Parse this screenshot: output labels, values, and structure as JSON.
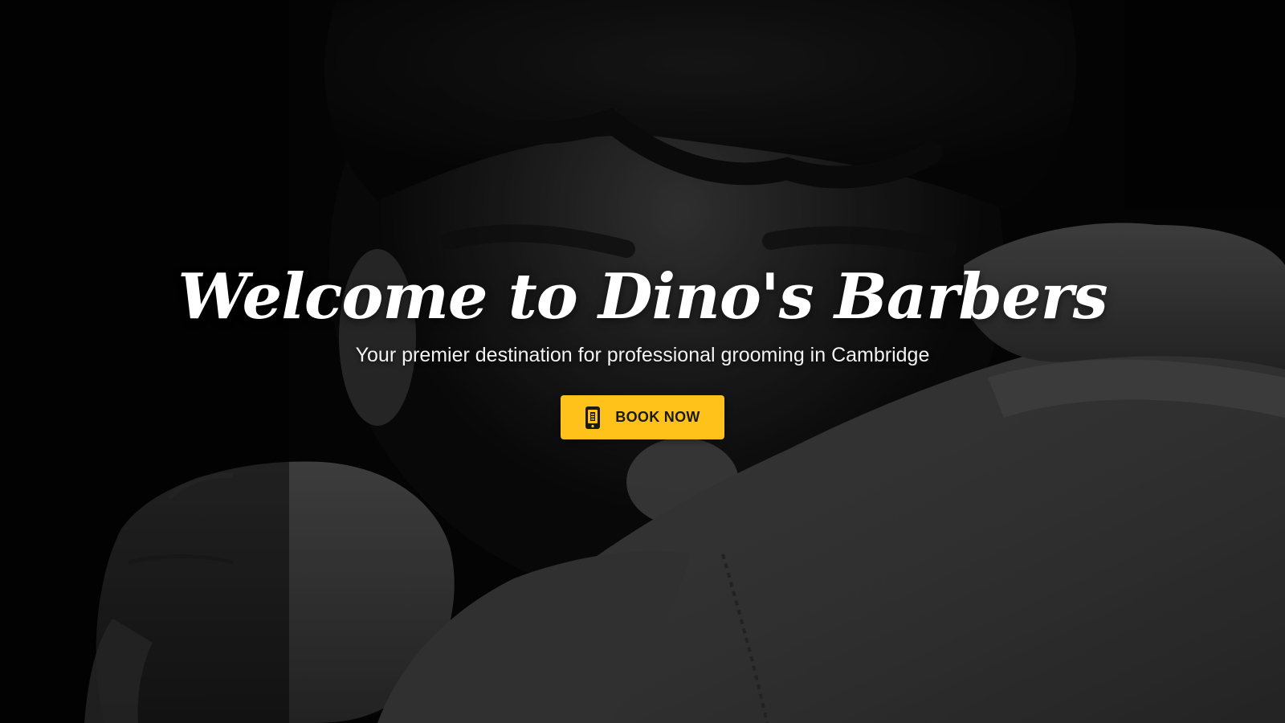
{
  "hero": {
    "title": "Welcome to Dino's Barbers",
    "subtitle": "Your premier destination for professional grooming in Cambridge",
    "cta": {
      "label": "BOOK NOW",
      "icon": "mobile-phone-icon"
    },
    "background_image": "monochrome-photo-man-pulling-shirt-over-face"
  },
  "colors": {
    "accent": "#ffc21a",
    "title_text": "#ffffff",
    "button_text": "#1a1a1a",
    "background": "#050505"
  }
}
